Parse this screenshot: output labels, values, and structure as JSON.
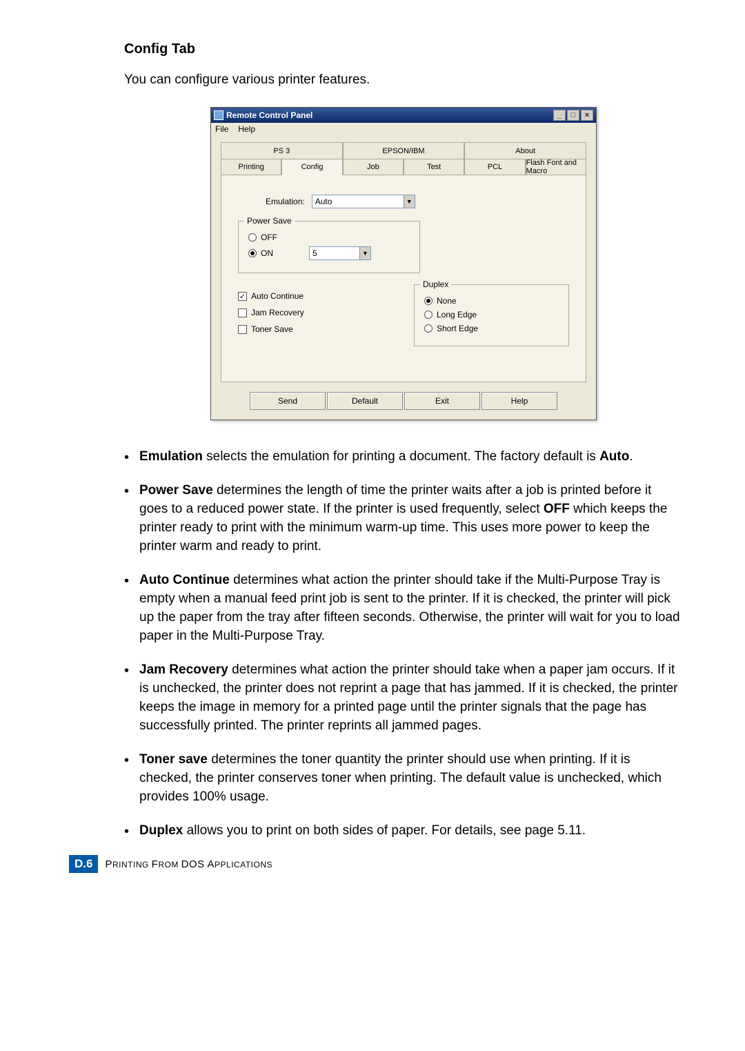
{
  "heading": "Config Tab",
  "intro": "You can configure various printer features.",
  "window": {
    "title": "Remote Control Panel",
    "minimize": "_",
    "maximize": "□",
    "close": "×",
    "menu": {
      "file": "File",
      "help": "Help"
    },
    "tabs_back": {
      "ps3": "PS 3",
      "epson": "EPSON/IBM",
      "about": "About"
    },
    "tabs_front": {
      "printing": "Printing",
      "config": "Config",
      "job": "Job",
      "test": "Test",
      "pcl": "PCL",
      "flash": "Flash Font and Macro"
    },
    "emulation_label": "Emulation:",
    "emulation_value": "Auto",
    "powersave": {
      "title": "Power Save",
      "off": "OFF",
      "on": "ON",
      "value": "5"
    },
    "checks": {
      "auto_continue": "Auto Continue",
      "jam_recovery": "Jam Recovery",
      "toner_save": "Toner Save"
    },
    "duplex": {
      "title": "Duplex",
      "none": "None",
      "long": "Long Edge",
      "short": "Short Edge"
    },
    "buttons": {
      "send": "Send",
      "default": "Default",
      "exit": "Exit",
      "help": "Help"
    }
  },
  "bullets": {
    "emu_1": "Emulation",
    "emu_2": " selects the emulation for printing a document. The factory default is ",
    "emu_3": "Auto",
    "emu_4": ".",
    "ps_1": "Power Save",
    "ps_2": " determines the length of time the printer waits after a job is printed before it goes to a reduced power state. If the printer is used frequently, select ",
    "ps_3": "OFF",
    "ps_4": " which keeps the printer ready to print with the minimum warm-up time. This uses more power to keep the printer warm and ready to print.",
    "ac_1": "Auto Continue",
    "ac_2": " determines what action the printer should take if the Multi-Purpose Tray is empty when a manual feed print job is sent to the printer. If it is checked, the printer will pick up the paper from the tray after fifteen seconds. Otherwise, the printer will wait for you to load paper in the Multi-Purpose Tray.",
    "jr_1": "Jam Recovery",
    "jr_2": " determines what action the printer should take when a paper jam occurs. If it is unchecked, the printer does not reprint a page that has jammed. If it is checked, the printer keeps the image in memory for a printed page until the printer signals that the page has successfully printed. The printer reprints all jammed pages.",
    "ts_1": "Toner save",
    "ts_2": " determines the toner quantity the printer should use when printing. If it is checked, the printer conserves toner when printing. The default value is unchecked, which provides 100% usage.",
    "dp_1": "Duplex",
    "dp_2": " allows you to print on both sides of paper. For details, see page 5.11."
  },
  "footer": {
    "badge": "D.6",
    "text_1": "P",
    "text_2": "RINTING ",
    "text_3": "F",
    "text_4": "ROM ",
    "text_5": "DOS A",
    "text_6": "PPLICATIONS"
  }
}
